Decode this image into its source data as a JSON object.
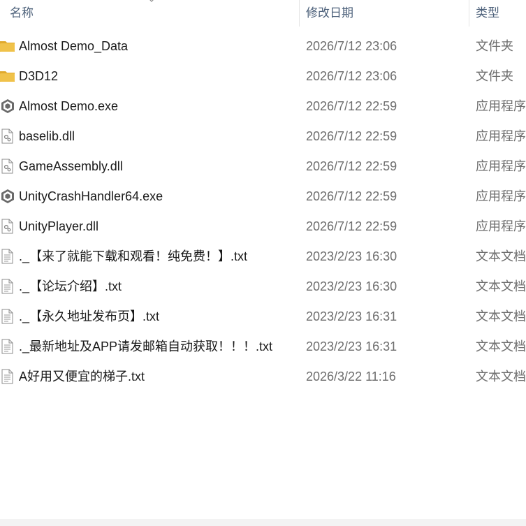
{
  "columns": {
    "name": "名称",
    "date": "修改日期",
    "type": "类型"
  },
  "icon_colors": {
    "folder": "#f0c24a",
    "folder_tab": "#e0a92c",
    "unity": "#6a6a6a"
  },
  "files": [
    {
      "name": "Almost Demo_Data",
      "date": "2026/7/12 23:06",
      "type": "文件夹",
      "icon": "folder-icon"
    },
    {
      "name": "D3D12",
      "date": "2026/7/12 23:06",
      "type": "文件夹",
      "icon": "folder-icon"
    },
    {
      "name": "Almost Demo.exe",
      "date": "2026/7/12 22:59",
      "type": "应用程序",
      "icon": "unity-exe-icon"
    },
    {
      "name": "baselib.dll",
      "date": "2026/7/12 22:59",
      "type": "应用程序",
      "icon": "dll-file-icon"
    },
    {
      "name": "GameAssembly.dll",
      "date": "2026/7/12 22:59",
      "type": "应用程序",
      "icon": "dll-file-icon"
    },
    {
      "name": "UnityCrashHandler64.exe",
      "date": "2026/7/12 22:59",
      "type": "应用程序",
      "icon": "unity-exe-icon"
    },
    {
      "name": "UnityPlayer.dll",
      "date": "2026/7/12 22:59",
      "type": "应用程序",
      "icon": "dll-file-icon"
    },
    {
      "name": "._【来了就能下载和观看！纯免费！】.txt",
      "date": "2023/2/23 16:30",
      "type": "文本文档",
      "icon": "text-file-icon"
    },
    {
      "name": "._【论坛介绍】.txt",
      "date": "2023/2/23 16:30",
      "type": "文本文档",
      "icon": "text-file-icon"
    },
    {
      "name": "._【永久地址发布页】.txt",
      "date": "2023/2/23 16:31",
      "type": "文本文档",
      "icon": "text-file-icon"
    },
    {
      "name": "._最新地址及APP请发邮箱自动获取！！！.txt",
      "date": "2023/2/23 16:31",
      "type": "文本文档",
      "icon": "text-file-icon"
    },
    {
      "name": "A好用又便宜的梯子.txt",
      "date": "2026/3/22 11:16",
      "type": "文本文档",
      "icon": "text-file-icon"
    }
  ]
}
